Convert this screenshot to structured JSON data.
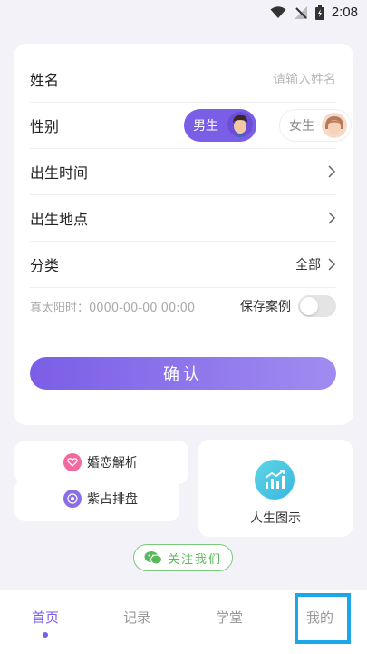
{
  "status_bar": {
    "time": "2:08"
  },
  "form": {
    "name": {
      "label": "姓名",
      "placeholder": "请输入姓名"
    },
    "gender": {
      "label": "性别",
      "male": "男生",
      "female": "女生"
    },
    "birth_time": {
      "label": "出生时间"
    },
    "birth_place": {
      "label": "出生地点"
    },
    "category": {
      "label": "分类",
      "value": "全部"
    },
    "solar_time": "真太阳时：0000-00-00 00:00",
    "save_case": "保存案例",
    "confirm": "确认"
  },
  "features": {
    "marriage": "婚恋解析",
    "ziwei": "紫占排盘",
    "life_chart": "人生图示"
  },
  "follow": "关注我们",
  "nav": {
    "home": "首页",
    "records": "记录",
    "academy": "学堂",
    "mine": "我的"
  },
  "colors": {
    "accent": "#7b5ee6",
    "wechat_green": "#5cb85c",
    "highlight": "#1ea7e8"
  }
}
